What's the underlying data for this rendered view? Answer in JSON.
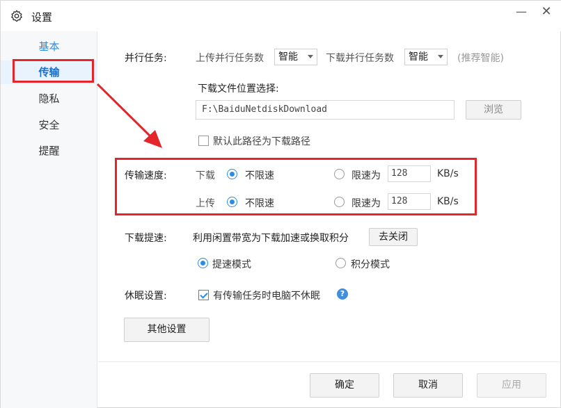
{
  "window": {
    "title": "设置",
    "minimize_glyph": "—",
    "close_glyph": "✕",
    "icon": "gear-icon"
  },
  "sidebar": {
    "items": [
      {
        "label": "基本"
      },
      {
        "label": "传输"
      },
      {
        "label": "隐私"
      },
      {
        "label": "安全"
      },
      {
        "label": "提醒"
      }
    ]
  },
  "parallel": {
    "label": "并行任务:",
    "upload_label": "上传并行任务数",
    "upload_value": "智能",
    "download_label": "下载并行任务数",
    "download_value": "智能",
    "hint": "(推荐智能)"
  },
  "download_location": {
    "label": "下载文件位置选择:",
    "path": "F:\\BaiduNetdiskDownload",
    "browse_button": "浏览",
    "default_checkbox_label": "默认此路径为下载路径",
    "default_checked": false
  },
  "speed": {
    "label": "传输速度:",
    "download": {
      "label": "下载",
      "unlimited_label": "不限速",
      "unlimited_selected": true,
      "limit_label": "限速为",
      "limit_value": "128",
      "unit": "KB/s"
    },
    "upload": {
      "label": "上传",
      "unlimited_label": "不限速",
      "unlimited_selected": true,
      "limit_label": "限速为",
      "limit_value": "128",
      "unit": "KB/s"
    }
  },
  "boost": {
    "label": "下载提速:",
    "description": "利用闲置带宽为下载加速或换取积分",
    "toggle_button": "去关闭",
    "speed_mode_label": "提速模式",
    "speed_mode_selected": true,
    "points_mode_label": "积分模式",
    "points_mode_selected": false
  },
  "sleep": {
    "label": "休眠设置:",
    "checkbox_label": "有传输任务时电脑不休眠",
    "checked": true,
    "help_glyph": "?"
  },
  "other_settings_button": "其他设置",
  "footer": {
    "ok": "确定",
    "cancel": "取消",
    "apply": "应用"
  },
  "colors": {
    "accent": "#2a8ce5",
    "annotation": "#e4262a"
  }
}
